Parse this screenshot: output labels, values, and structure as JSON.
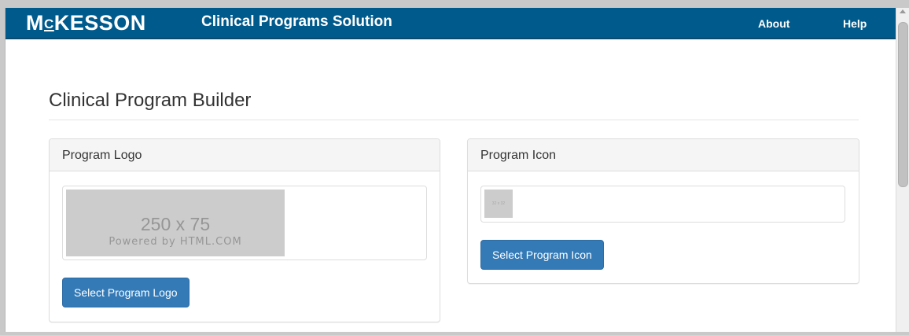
{
  "navbar": {
    "brand_prefix": "M",
    "brand_c": "C",
    "brand_rest": "KESSON",
    "app_title": "Clinical Programs Solution",
    "links": [
      {
        "label": "About"
      },
      {
        "label": "Help"
      }
    ]
  },
  "page": {
    "title": "Clinical Program Builder"
  },
  "logo_panel": {
    "heading": "Program Logo",
    "placeholder_dims": "250 x 75",
    "placeholder_powered": "Powered by HTML.COM",
    "button_label": "Select Program Logo"
  },
  "icon_panel": {
    "heading": "Program Icon",
    "placeholder_dims": "32 x 32",
    "button_label": "Select Program Icon"
  },
  "colors": {
    "navbar": "#005a8c",
    "primary_button": "#337ab7",
    "placeholder": "#cccccc"
  }
}
